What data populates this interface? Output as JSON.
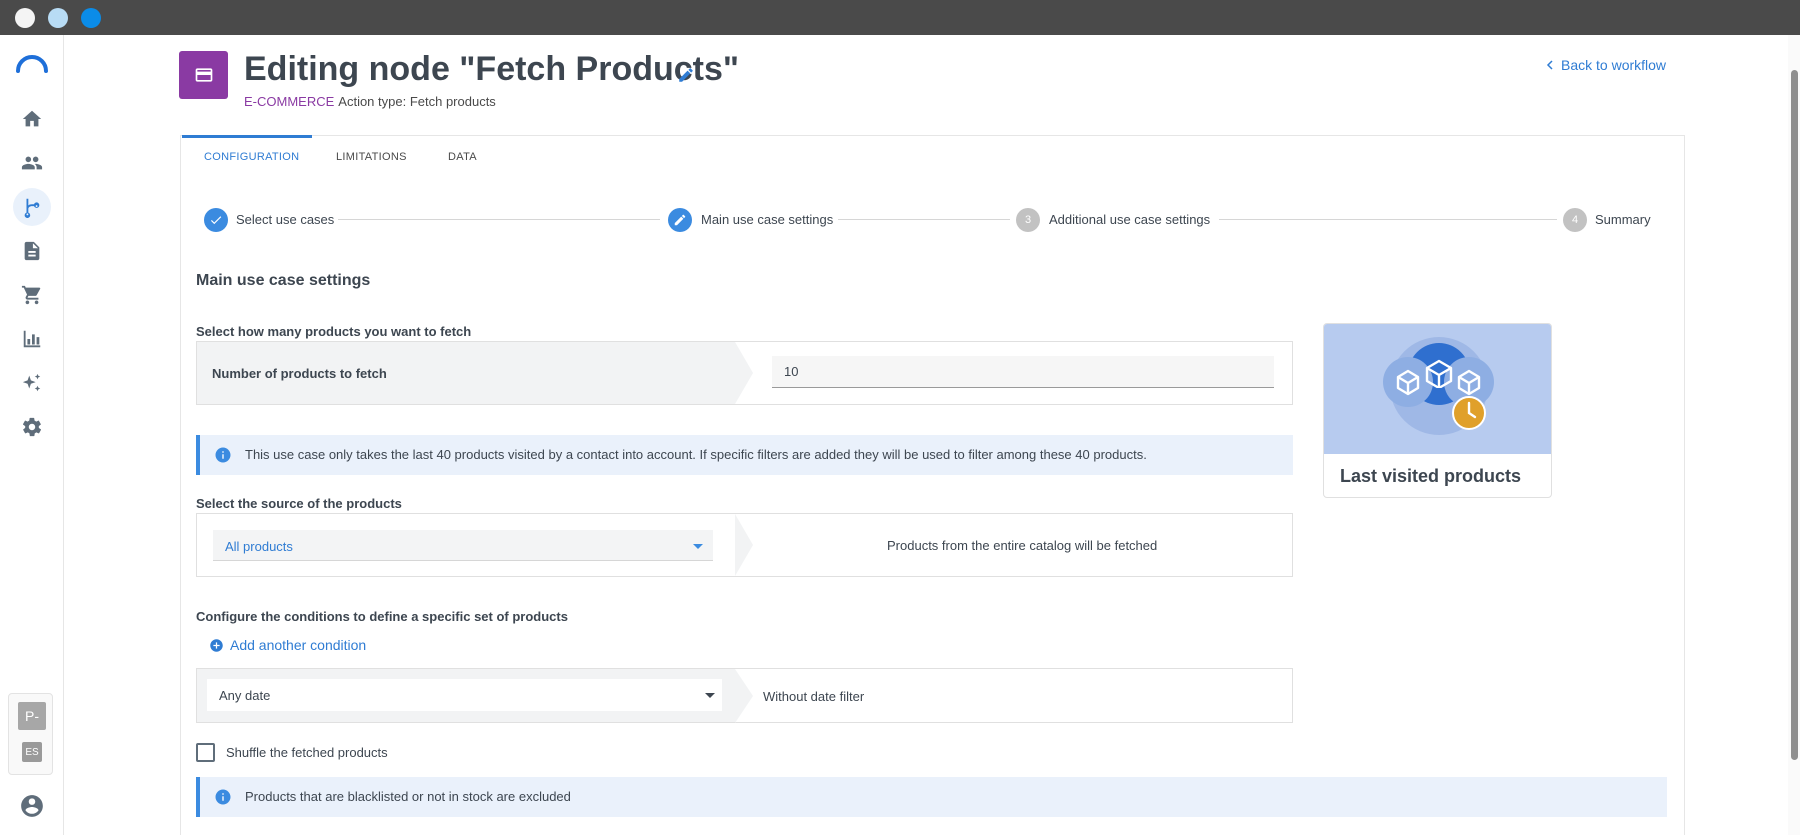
{
  "header": {
    "title": "Editing node \"Fetch Products\"",
    "category": "E-COMMERCE",
    "action_type": "Action type: Fetch products",
    "back_link": "Back to workflow"
  },
  "sidebar": {
    "items": [
      {
        "name": "home-icon"
      },
      {
        "name": "contacts-icon"
      },
      {
        "name": "workflow-icon",
        "active": true
      },
      {
        "name": "document-icon"
      },
      {
        "name": "cart-icon"
      },
      {
        "name": "analytics-icon"
      },
      {
        "name": "ai-sparkle-icon"
      },
      {
        "name": "settings-icon"
      }
    ],
    "profile_initial": "P-",
    "language": "ES"
  },
  "tabs": [
    {
      "label": "CONFIGURATION",
      "active": true
    },
    {
      "label": "LIMITATIONS"
    },
    {
      "label": "DATA"
    }
  ],
  "stepper": {
    "steps": [
      {
        "label": "Select use cases",
        "state": "done"
      },
      {
        "label": "Main use case settings",
        "state": "current"
      },
      {
        "label": "Additional use case settings",
        "number": "3",
        "state": "todo"
      },
      {
        "label": "Summary",
        "number": "4",
        "state": "todo"
      }
    ]
  },
  "main": {
    "section_title": "Main use case settings",
    "fetch_count": {
      "label": "Select how many products you want to fetch",
      "row_label": "Number of products to fetch",
      "value": "10"
    },
    "info_visited": "This use case only takes the last 40 products visited by a contact into account. If specific filters are added they will be used to filter among these 40 products.",
    "source": {
      "label": "Select the source of the products",
      "selected": "All products",
      "description": "Products from the entire catalog will be fetched"
    },
    "conditions": {
      "label": "Configure the conditions to define a specific set of products",
      "add_label": "Add another condition",
      "date_selected": "Any date",
      "date_description": "Without date filter"
    },
    "shuffle": {
      "label": "Shuffle the fetched products",
      "checked": false
    },
    "info_excluded": "Products that are blacklisted or not in stock are excluded"
  },
  "use_case_card": {
    "title": "Last visited products"
  },
  "colors": {
    "accent": "#2f7cd3",
    "category": "#8a3aa3",
    "info_bg": "#eaf1fb"
  }
}
